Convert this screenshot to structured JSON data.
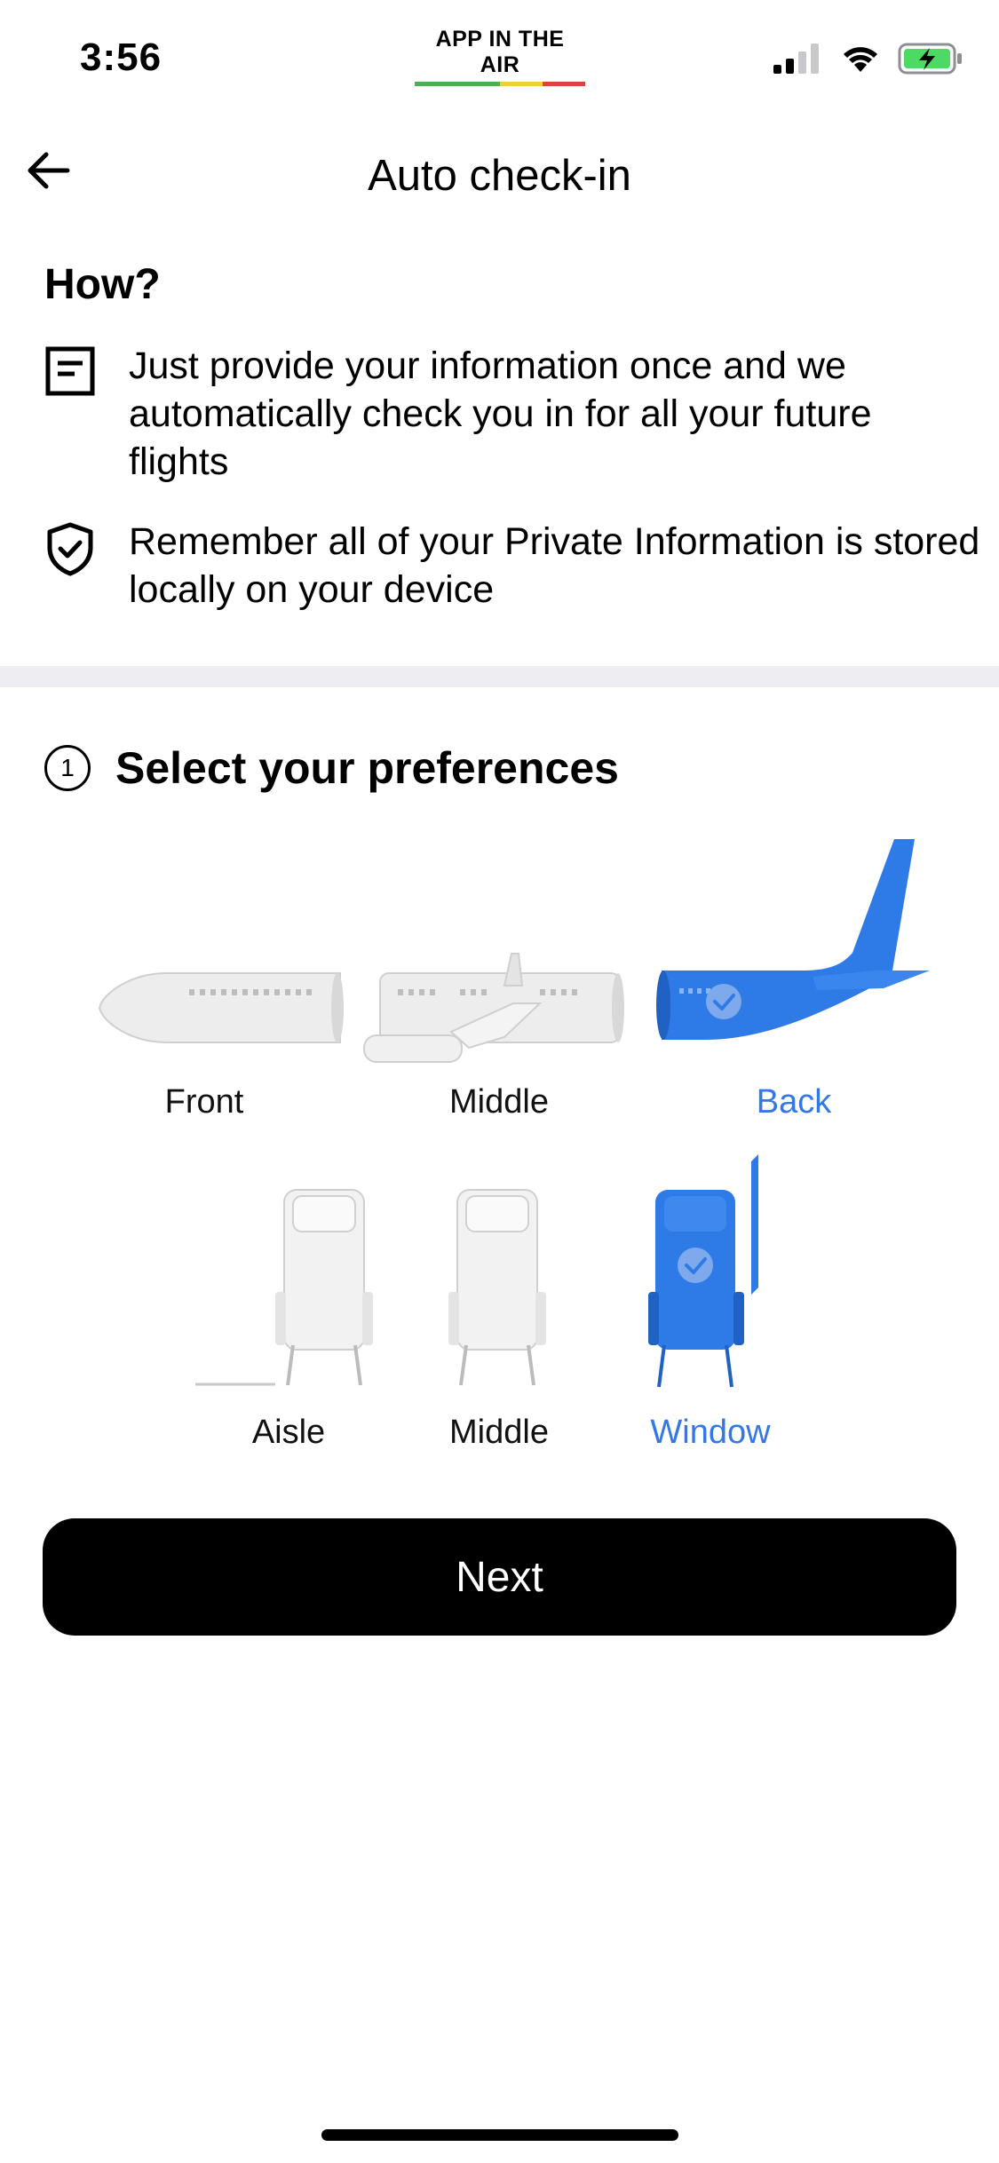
{
  "status_bar": {
    "time": "3:56",
    "brand": "APP IN THE AIR"
  },
  "header": {
    "title": "Auto check-in"
  },
  "how": {
    "title": "How?",
    "items": [
      {
        "icon": "document-icon",
        "text": "Just provide your information once and we automatically check you in for all your future flights"
      },
      {
        "icon": "shield-check-icon",
        "text": "Remember all of your Private Information is stored locally on your device"
      }
    ]
  },
  "preferences": {
    "step": "1",
    "title": "Select your preferences",
    "plane_sections": [
      {
        "label": "Front",
        "selected": false
      },
      {
        "label": "Middle",
        "selected": false
      },
      {
        "label": "Back",
        "selected": true
      }
    ],
    "seat_types": [
      {
        "label": "Aisle",
        "selected": false
      },
      {
        "label": "Middle",
        "selected": false
      },
      {
        "label": "Window",
        "selected": true
      }
    ]
  },
  "actions": {
    "next_label": "Next"
  },
  "colors": {
    "accent": "#3478e6",
    "unselected": "#e6e6e6",
    "button": "#000000"
  }
}
